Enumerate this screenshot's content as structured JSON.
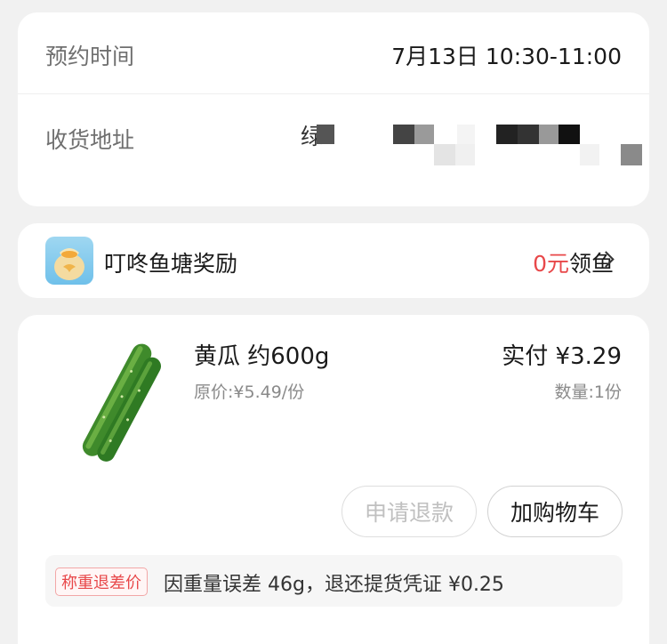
{
  "order_info": {
    "appointment_label": "预约时间",
    "appointment_value": "7月13日 10:30-11:00",
    "address_label": "收货地址",
    "address_visible_char": "绿"
  },
  "pond": {
    "label": "叮咚鱼塘奖励",
    "amount": "0元",
    "action": "领鱼",
    "icon": "sack-icon"
  },
  "product": {
    "name": "黄瓜 约600g",
    "original_price": "原价:¥5.49/份",
    "paid": "实付 ¥3.29",
    "quantity": "数量:1份",
    "image": "cucumber"
  },
  "actions": {
    "refund_label": "申请退款",
    "cart_label": "加购物车"
  },
  "notice": {
    "badge": "称重退差价",
    "text": "因重量误差 46g，退还提货凭证 ¥0.25"
  },
  "colors": {
    "accent_red": "#e8484a",
    "background": "#f1f1f1",
    "card": "#ffffff"
  }
}
